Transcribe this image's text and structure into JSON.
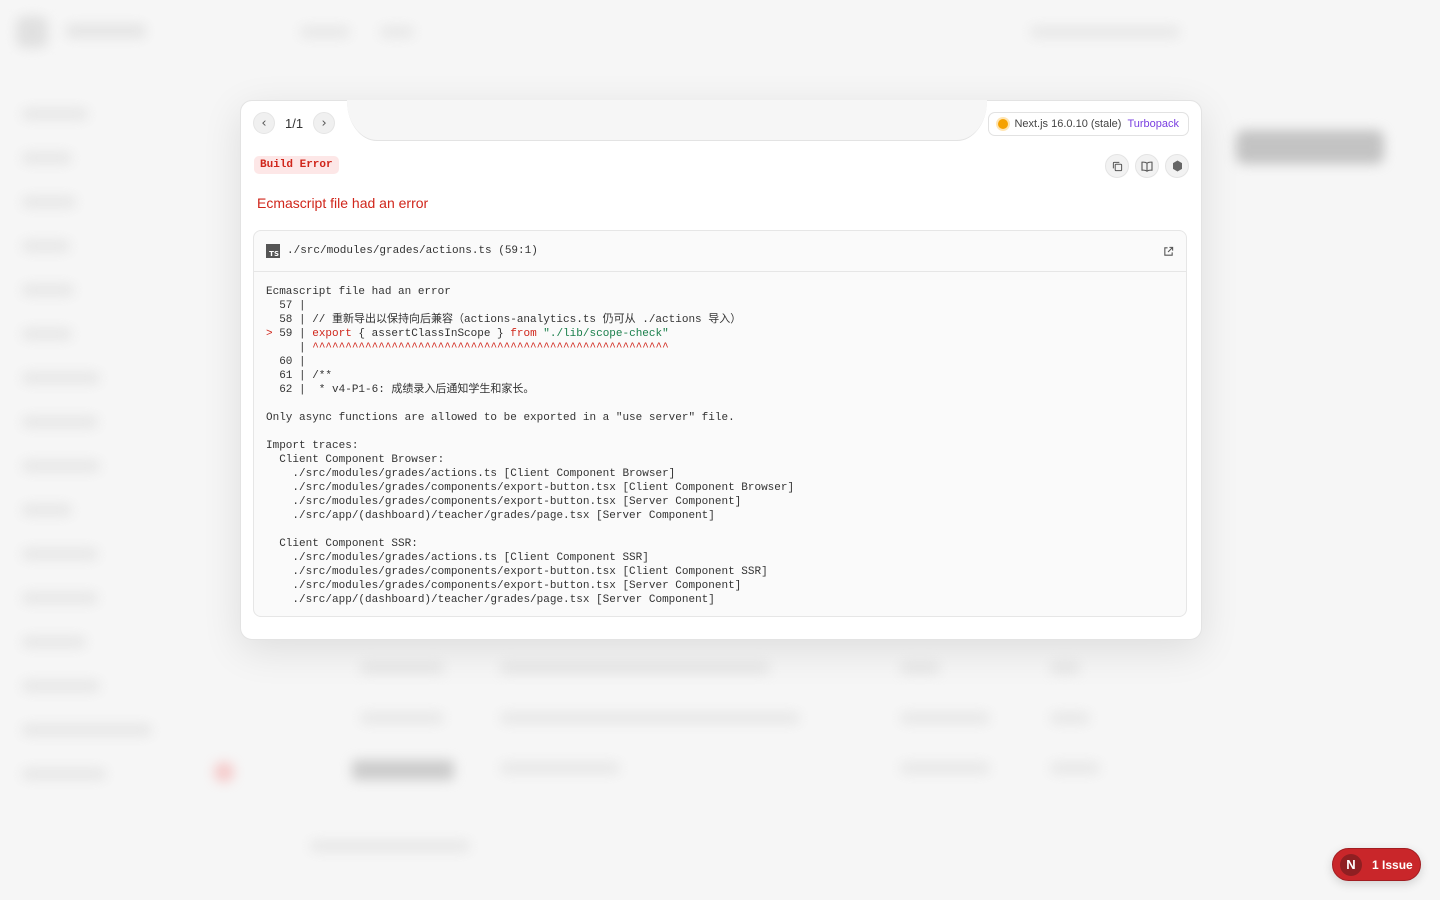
{
  "navigation": {
    "counter": "1/1",
    "prev_glyph": "‹",
    "next_glyph": "›"
  },
  "version": {
    "label": "Next.js 16.0.10 (stale)",
    "bundler": "Turbopack"
  },
  "error": {
    "badge": "Build Error",
    "title": "Ecmascript file had an error",
    "file_path": "./src/modules/grades/actions.ts (59:1)",
    "file_icon_label": "TS"
  },
  "code": {
    "header": "Ecmascript file had an error",
    "line57": "  57 |",
    "line58": "  58 | // 重新导出以保持向后兼容（actions-analytics.ts 仍可从 ./actions 导入）",
    "line59_marker": "> ",
    "line59_num": "59 | ",
    "line59_kw_export": "export",
    "line59_mid": " { assertClassInScope } ",
    "line59_kw_from": "from",
    "line59_str": "\"./lib/scope-check\"",
    "caret_prefix": "     | ",
    "caret_line": "^^^^^^^^^^^^^^^^^^^^^^^^^^^^^^^^^^^^^^^^^^^^^^^^^^^^^^",
    "line60": "  60 |",
    "line61": "  61 | /**",
    "line62": "  62 |  * v4-P1-6: 成绩录入后通知学生和家长。",
    "message": "Only async functions are allowed to be exported in a \"use server\" file.",
    "import_traces_title": "Import traces:",
    "trace_browser_title": "  Client Component Browser:",
    "trace_browser": [
      "    ./src/modules/grades/actions.ts [Client Component Browser]",
      "    ./src/modules/grades/components/export-button.tsx [Client Component Browser]",
      "    ./src/modules/grades/components/export-button.tsx [Server Component]",
      "    ./src/app/(dashboard)/teacher/grades/page.tsx [Server Component]"
    ],
    "trace_ssr_title": "  Client Component SSR:",
    "trace_ssr": [
      "    ./src/modules/grades/actions.ts [Client Component SSR]",
      "    ./src/modules/grades/components/export-button.tsx [Client Component SSR]",
      "    ./src/modules/grades/components/export-button.tsx [Server Component]",
      "    ./src/app/(dashboard)/teacher/grades/page.tsx [Server Component]"
    ]
  },
  "issue_indicator": {
    "logo_letter": "N",
    "label": "1 Issue"
  },
  "icons": [
    "chevron-left-icon",
    "chevron-right-icon",
    "copy-icon",
    "docs-icon",
    "nextjs-hex-icon",
    "external-link-icon"
  ],
  "colors": {
    "error_red": "#d0261b",
    "turbopack": "#7a3fe0",
    "status_dot": "#f5a100",
    "issue_pill": "#c9262a"
  }
}
